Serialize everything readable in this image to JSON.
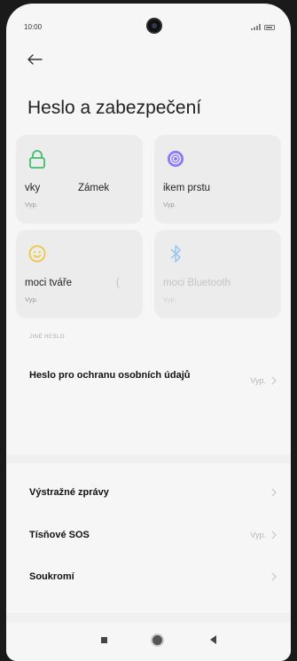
{
  "status_bar": {
    "time": "10:00"
  },
  "header": {
    "title": "Heslo a zabezpečení"
  },
  "tiles": [
    {
      "label": "vky",
      "extra": "Zámek",
      "status": "Vyp.",
      "icon": "lock-icon",
      "icon_color": "#3cc06a"
    },
    {
      "label": "ikem prstu",
      "extra": "",
      "status": "Vyp.",
      "icon": "fingerprint-icon",
      "icon_color": "#8b7cf6"
    },
    {
      "label": "moci tváře",
      "extra": "(",
      "status": "Vyp.",
      "icon": "face-icon",
      "icon_color": "#f1c232"
    },
    {
      "label": "moci Bluetooth",
      "extra": "",
      "status": "Vyp.",
      "icon": "bluetooth-icon",
      "icon_color": "#9dc6f2"
    }
  ],
  "section": {
    "header": "JINÉ HESLO"
  },
  "rows": [
    {
      "label": "Heslo pro ochranu osobních údajů",
      "value": "Vyp."
    },
    {
      "label": "Výstražné zprávy",
      "value": ""
    },
    {
      "label": "Tísňové SOS",
      "value": "Vyp."
    },
    {
      "label": "Soukromí",
      "value": ""
    }
  ]
}
